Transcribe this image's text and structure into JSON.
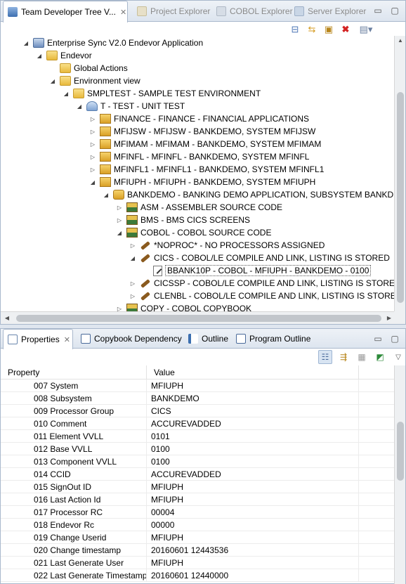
{
  "top_panel": {
    "tabs": [
      {
        "label": "Team Developer Tree V...",
        "icon": "tree-icon",
        "active": true
      },
      {
        "label": "Project Explorer",
        "icon": "project-explorer-icon",
        "active": false
      },
      {
        "label": "COBOL Explorer",
        "icon": "cobol-explorer-icon",
        "active": false
      },
      {
        "label": "Server Explorer",
        "icon": "server-explorer-icon",
        "active": false
      }
    ],
    "toolbar_icons": [
      "collapse-all-icon",
      "link-with-editor-icon",
      "new-item-icon",
      "delete-icon",
      "view-menu-icon"
    ],
    "tree": [
      {
        "label": "Enterprise Sync V2.0 Endevor Application",
        "kind": "app",
        "expanded": true
      },
      {
        "label": "Endevor",
        "kind": "folder-open",
        "expanded": true
      },
      {
        "label": "Global Actions",
        "kind": "folder",
        "expanded": null
      },
      {
        "label": "Environment view",
        "kind": "folder-open",
        "expanded": true
      },
      {
        "label": "SMPLTEST - SAMPLE TEST ENVIRONMENT",
        "kind": "env",
        "expanded": true
      },
      {
        "label": "T - TEST - UNIT TEST",
        "kind": "stage",
        "expanded": true
      },
      {
        "label": "FINANCE - FINANCE - FINANCIAL APPLICATIONS",
        "kind": "system",
        "expanded": false
      },
      {
        "label": "MFIJSW - MFIJSW - BANKDEMO, SYSTEM MFIJSW",
        "kind": "system",
        "expanded": false
      },
      {
        "label": "MFIMAM - MFIMAM - BANKDEMO, SYSTEM MFIMAM",
        "kind": "system",
        "expanded": false
      },
      {
        "label": "MFINFL - MFINFL - BANKDEMO, SYSTEM MFINFL",
        "kind": "system",
        "expanded": false
      },
      {
        "label": "MFINFL1 - MFINFL1 - BANKDEMO, SYSTEM MFINFL1",
        "kind": "system",
        "expanded": false
      },
      {
        "label": "MFIUPH - MFIUPH - BANKDEMO, SYSTEM MFIUPH",
        "kind": "system",
        "expanded": true
      },
      {
        "label": "BANKDEMO - BANKING DEMO APPLICATION, SUBSYSTEM BANKDEMO",
        "kind": "subsystem",
        "expanded": true
      },
      {
        "label": "ASM - ASSEMBLER SOURCE CODE",
        "kind": "type",
        "expanded": false
      },
      {
        "label": "BMS - BMS CICS SCREENS",
        "kind": "type",
        "expanded": false
      },
      {
        "label": "COBOL - COBOL SOURCE CODE",
        "kind": "type",
        "expanded": true
      },
      {
        "label": "*NOPROC* - NO PROCESSORS ASSIGNED",
        "kind": "proc",
        "expanded": false
      },
      {
        "label": "CICS - COBOL/LE COMPILE AND LINK, LISTING IS STORED",
        "kind": "proc",
        "expanded": true
      },
      {
        "label": "BBANK10P - COBOL - MFIUPH - BANKDEMO - 0100",
        "kind": "element",
        "expanded": null
      },
      {
        "label": "CICSSP - COBOL/LE COMPILE AND LINK, LISTING IS STORED",
        "kind": "proc",
        "expanded": false
      },
      {
        "label": "CLENBL - COBOL/LE COMPILE AND LINK, LISTING IS STORED",
        "kind": "proc",
        "expanded": false
      },
      {
        "label": "COPY - COBOL COPYBOOK",
        "kind": "type",
        "expanded": false
      }
    ]
  },
  "bottom_panel": {
    "tabs": [
      {
        "label": "Properties",
        "icon": "properties-icon",
        "active": true
      },
      {
        "label": "Copybook Dependency",
        "icon": "copybook-dependency-icon",
        "active": false
      },
      {
        "label": "Outline",
        "icon": "outline-icon",
        "active": false
      },
      {
        "label": "Program Outline",
        "icon": "program-outline-icon",
        "active": false
      }
    ],
    "toolbar_icons": [
      "show-categories-icon",
      "filter-advanced-icon",
      "restore-default-icon",
      "pin-icon",
      "view-menu-icon"
    ],
    "columns": [
      "Property",
      "Value"
    ],
    "rows": [
      {
        "property": "007 System",
        "value": "MFIUPH"
      },
      {
        "property": "008 Subsystem",
        "value": "BANKDEMO"
      },
      {
        "property": "009 Processor Group",
        "value": "CICS"
      },
      {
        "property": "010 Comment",
        "value": "ACCUREVADDED"
      },
      {
        "property": "011 Element VVLL",
        "value": "0101"
      },
      {
        "property": "012 Base VVLL",
        "value": "0100"
      },
      {
        "property": "013 Component VVLL",
        "value": "0100"
      },
      {
        "property": "014 CCID",
        "value": "ACCUREVADDED"
      },
      {
        "property": "015 SignOut ID",
        "value": "MFIUPH"
      },
      {
        "property": "016 Last Action Id",
        "value": "MFIUPH"
      },
      {
        "property": "017 Processor RC",
        "value": "00004"
      },
      {
        "property": "018 Endevor Rc",
        "value": "00000"
      },
      {
        "property": "019 Change Userid",
        "value": "MFIUPH"
      },
      {
        "property": "020 Change timestamp",
        "value": "20160601 12443536"
      },
      {
        "property": "021 Last Generate User",
        "value": "MFIUPH"
      },
      {
        "property": "022 Last Generate Timestamp",
        "value": "20160601 12440000"
      }
    ]
  }
}
